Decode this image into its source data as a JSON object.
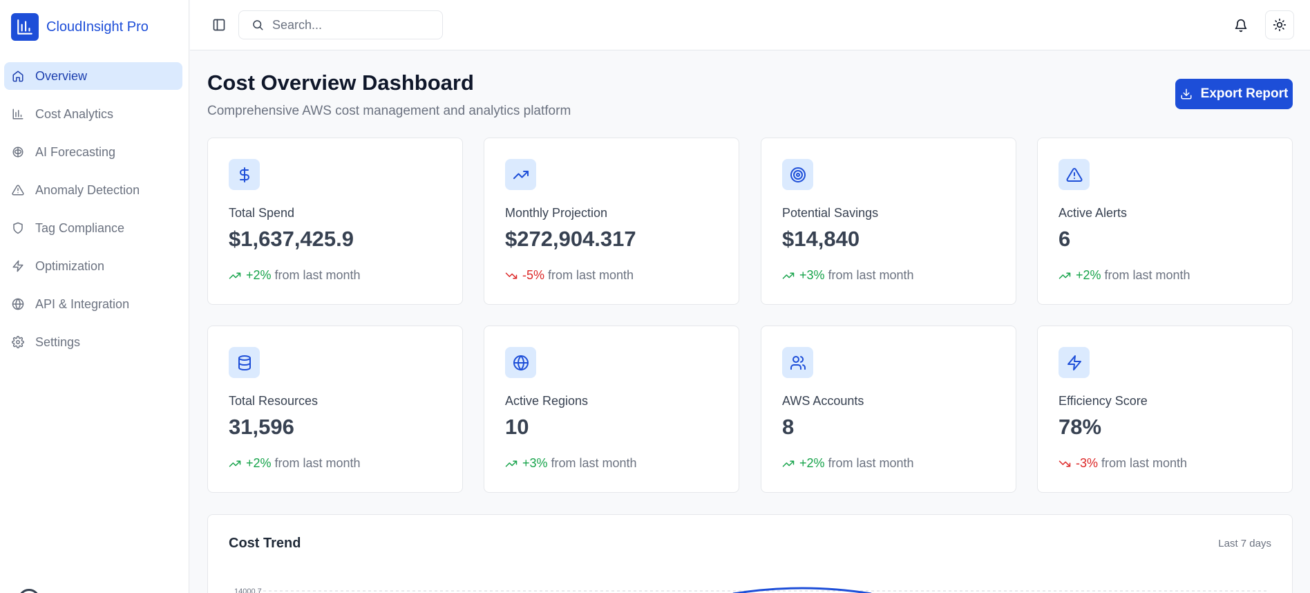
{
  "app": {
    "name": "CloudInsight Pro"
  },
  "sidebar": {
    "items": [
      {
        "label": "Overview",
        "icon": "home-icon",
        "active": true
      },
      {
        "label": "Cost Analytics",
        "icon": "bar-chart-icon"
      },
      {
        "label": "AI Forecasting",
        "icon": "brain-icon"
      },
      {
        "label": "Anomaly Detection",
        "icon": "alert-triangle-icon"
      },
      {
        "label": "Tag Compliance",
        "icon": "shield-icon"
      },
      {
        "label": "Optimization",
        "icon": "zap-icon"
      },
      {
        "label": "API & Integration",
        "icon": "globe-icon"
      },
      {
        "label": "Settings",
        "icon": "gear-icon"
      }
    ]
  },
  "topbar": {
    "search_placeholder": "Search..."
  },
  "header": {
    "title": "Cost Overview Dashboard",
    "subtitle": "Comprehensive AWS cost management and analytics platform",
    "export_label": "Export Report"
  },
  "cards": [
    {
      "label": "Total Spend",
      "value": "$1,637,425.9",
      "change": "+2%",
      "direction": "up",
      "suffix": "from last month",
      "icon": "dollar-icon"
    },
    {
      "label": "Monthly Projection",
      "value": "$272,904.317",
      "change": "-5%",
      "direction": "down",
      "suffix": "from last month",
      "icon": "trending-up-icon"
    },
    {
      "label": "Potential Savings",
      "value": "$14,840",
      "change": "+3%",
      "direction": "up",
      "suffix": "from last month",
      "icon": "target-icon"
    },
    {
      "label": "Active Alerts",
      "value": "6",
      "change": "+2%",
      "direction": "up",
      "suffix": "from last month",
      "icon": "alert-triangle-icon"
    },
    {
      "label": "Total Resources",
      "value": "31,596",
      "change": "+2%",
      "direction": "up",
      "suffix": "from last month",
      "icon": "database-icon"
    },
    {
      "label": "Active Regions",
      "value": "10",
      "change": "+3%",
      "direction": "up",
      "suffix": "from last month",
      "icon": "globe-icon"
    },
    {
      "label": "AWS Accounts",
      "value": "8",
      "change": "+2%",
      "direction": "up",
      "suffix": "from last month",
      "icon": "users-icon"
    },
    {
      "label": "Efficiency Score",
      "value": "78%",
      "change": "-3%",
      "direction": "down",
      "suffix": "from last month",
      "icon": "zap-icon"
    }
  ],
  "trend": {
    "title": "Cost Trend",
    "range": "Last 7 days",
    "y_tick": "14000.7"
  },
  "colors": {
    "accent": "#1d4ed8",
    "accent_light": "#dbeafe",
    "positive": "#16a34a",
    "negative": "#dc2626"
  }
}
